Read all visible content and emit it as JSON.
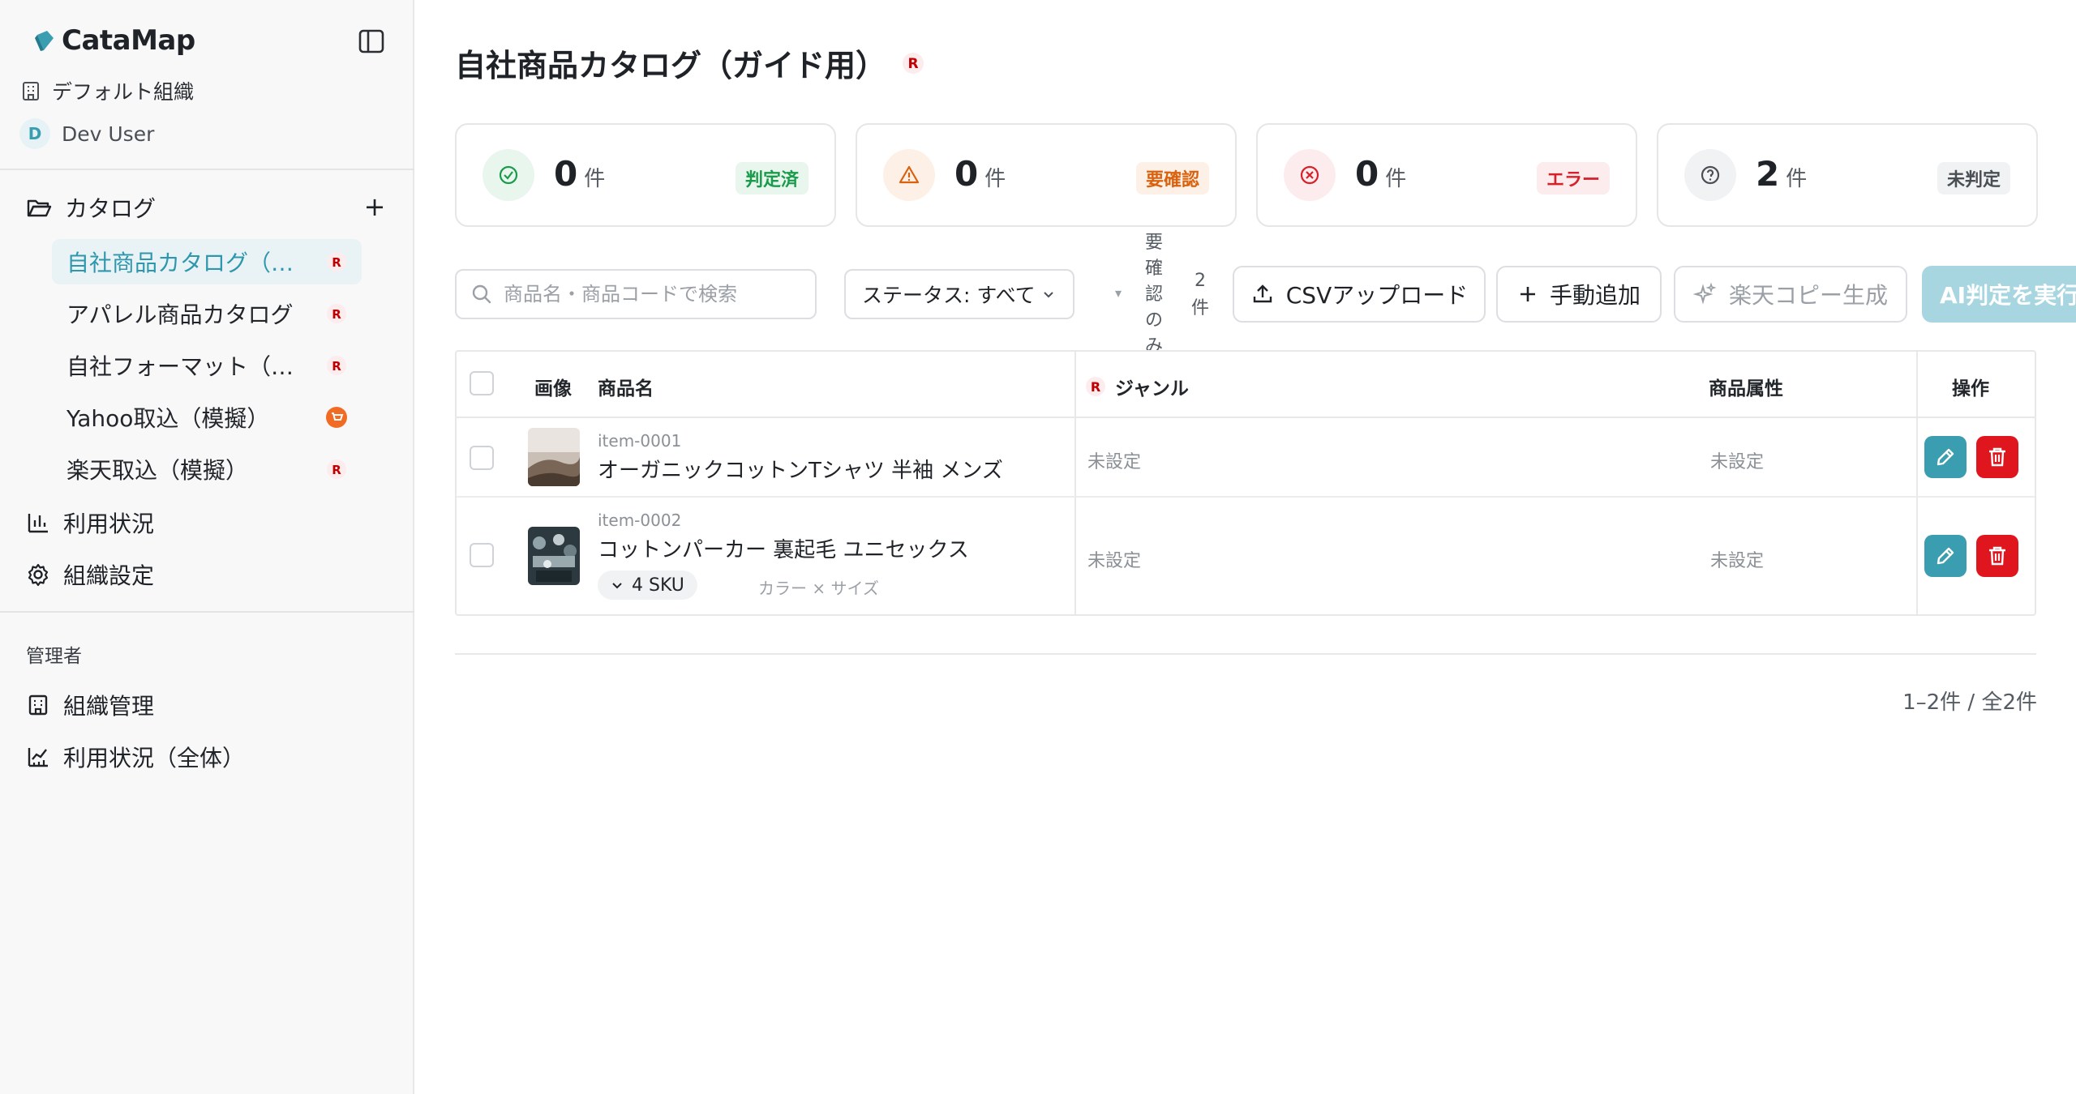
{
  "app": {
    "name": "CataMap"
  },
  "sidebar": {
    "org_name": "デフォルト組織",
    "user_initial": "D",
    "user_name": "Dev User",
    "catalog_section_label": "カタログ",
    "catalogs": [
      {
        "label": "自社商品カタログ（ガイド用）",
        "marketplace": "rakuten",
        "active": true
      },
      {
        "label": "アパレル商品カタログ",
        "marketplace": "rakuten",
        "active": false
      },
      {
        "label": "自社フォーマット（楽天）",
        "marketplace": "rakuten",
        "active": false
      },
      {
        "label": "Yahoo取込（模擬）",
        "marketplace": "yahoo",
        "active": false
      },
      {
        "label": "楽天取込（模擬）",
        "marketplace": "rakuten",
        "active": false
      }
    ],
    "usage_label": "利用状況",
    "org_settings_label": "組織設定",
    "admin_heading": "管理者",
    "org_management_label": "組織管理",
    "usage_all_label": "利用状況（全体）"
  },
  "page": {
    "title": "自社商品カタログ（ガイド用）",
    "marketplace_badge": "R"
  },
  "stats": [
    {
      "count": "0",
      "unit": "件",
      "label": "判定済",
      "icon": "check-circle-icon",
      "color": "#1a9b4b",
      "bg": "#e8f6ee"
    },
    {
      "count": "0",
      "unit": "件",
      "label": "要確認",
      "icon": "warning-triangle-icon",
      "color": "#d9620f",
      "bg": "#fdf0e6"
    },
    {
      "count": "0",
      "unit": "件",
      "label": "エラー",
      "icon": "x-circle-icon",
      "color": "#d6202a",
      "bg": "#fdeced"
    },
    {
      "count": "2",
      "unit": "件",
      "label": "未判定",
      "icon": "question-circle-icon",
      "color": "#4a4f55",
      "bg": "#f1f2f4"
    }
  ],
  "toolbar": {
    "search_placeholder": "商品名・商品コードで検索",
    "status_filter": "ステータス: すべて",
    "needs_review_only": "要確認のみ",
    "count_label": "2件",
    "csv_upload": "CSVアップロード",
    "manual_add": "手動追加",
    "rakuten_copy": "楽天コピー生成",
    "ai_judge": "AI判定を実行"
  },
  "table": {
    "headers": {
      "image": "画像",
      "name": "商品名",
      "genre": "ジャンル",
      "attributes": "商品属性",
      "actions": "操作"
    },
    "rows": [
      {
        "code": "item-0001",
        "name": "オーガニックコットンTシャツ 半袖 メンズ",
        "genre": "未設定",
        "attributes": "未設定",
        "sku": null,
        "sku_attrs": null
      },
      {
        "code": "item-0002",
        "name": "コットンパーカー 裏起毛 ユニセックス",
        "genre": "未設定",
        "attributes": "未設定",
        "sku": "4 SKU",
        "sku_attrs": "カラー × サイズ"
      }
    ]
  },
  "pagination": {
    "summary": "1–2件 / 全2件"
  }
}
